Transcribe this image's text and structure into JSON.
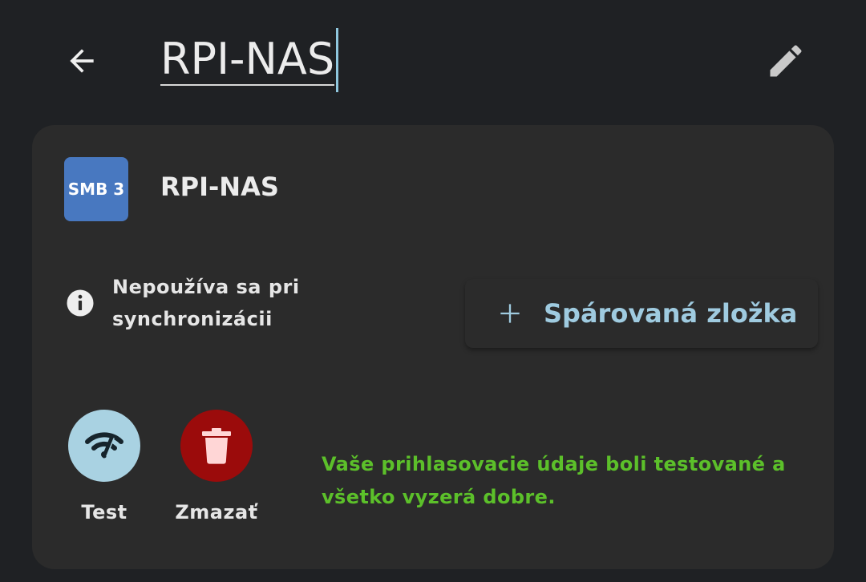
{
  "header": {
    "title_value": "RPI-NAS",
    "back_icon": "arrow-left-icon",
    "edit_icon": "pencil-icon"
  },
  "server": {
    "protocol_badge": "SMB 3",
    "name": "RPI-NAS"
  },
  "sync_info": {
    "icon": "info-icon",
    "text_line1": "Nepoužíva sa pri",
    "text_line2": "synchronizácii"
  },
  "pair_button": {
    "icon": "plus-icon",
    "label": "Spárovaná zložka"
  },
  "actions": {
    "test": {
      "icon": "wifi-signal-icon",
      "label": "Test"
    },
    "delete": {
      "icon": "trash-icon",
      "label": "Zmazať"
    }
  },
  "status": {
    "message": "Vaše prihlasovacie údaje boli testované a všetko vyzerá dobre."
  },
  "colors": {
    "background": "#1f2124",
    "card": "#2b2b2b",
    "badge": "#4878c0",
    "accent_blue": "#9fcbe0",
    "test_circle": "#a9d2e2",
    "delete_circle": "#9b0b0b",
    "success_green": "#5cc02a"
  }
}
